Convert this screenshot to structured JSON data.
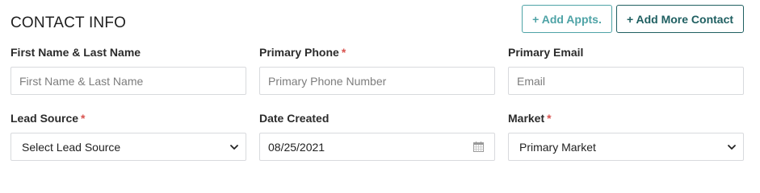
{
  "header": {
    "title": "CONTACT INFO",
    "add_appts_label": "+ Add Appts.",
    "add_contact_label": "+ Add More Contact"
  },
  "fields": {
    "name": {
      "label": "First Name & Last Name",
      "placeholder": "First Name & Last Name",
      "value": ""
    },
    "phone": {
      "label": "Primary Phone",
      "required_mark": "*",
      "placeholder": "Primary Phone Number",
      "value": ""
    },
    "email": {
      "label": "Primary Email",
      "placeholder": "Email",
      "value": ""
    },
    "lead_source": {
      "label": "Lead Source",
      "required_mark": "*",
      "selected": "Select Lead Source"
    },
    "date_created": {
      "label": "Date Created",
      "value": "08/25/2021"
    },
    "market": {
      "label": "Market",
      "required_mark": "*",
      "selected": "Primary Market"
    }
  },
  "icons": {
    "select_arrow": "chevron-down-icon",
    "date_picker": "calendar-icon"
  },
  "colors": {
    "accent_light": "#4ea3a6",
    "accent_dark": "#1f5f61",
    "required": "#d9534f",
    "border": "#d8dadd"
  }
}
